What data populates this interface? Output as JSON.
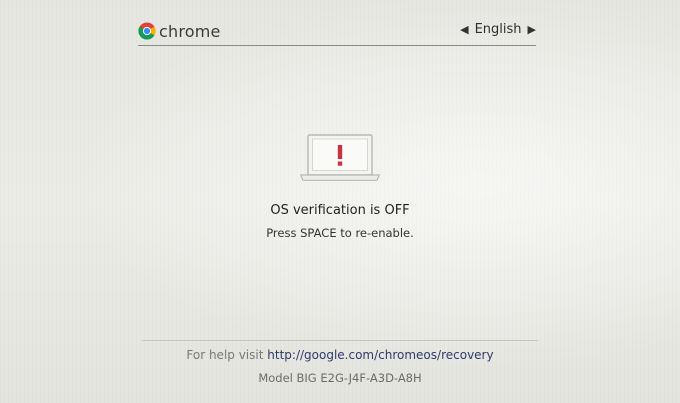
{
  "header": {
    "brand_text": "chrome",
    "language": "English",
    "prev_language_arrow": "◀",
    "next_language_arrow": "▶"
  },
  "icons": {
    "brand_logo": "chrome-logo-icon",
    "warning": "laptop-warning-icon"
  },
  "message": {
    "title": "OS verification is OFF",
    "subtitle": "Press SPACE to re-enable."
  },
  "footer": {
    "help_prefix": "For help visit",
    "help_link": "http://google.com/chromeos/recovery",
    "model_label": "Model",
    "model_value": "BIG E2G-J4F-A3D-A8H"
  },
  "colors": {
    "background": "#e8e8e3",
    "warning_red": "#c8323c",
    "link": "#2e3a6a"
  }
}
